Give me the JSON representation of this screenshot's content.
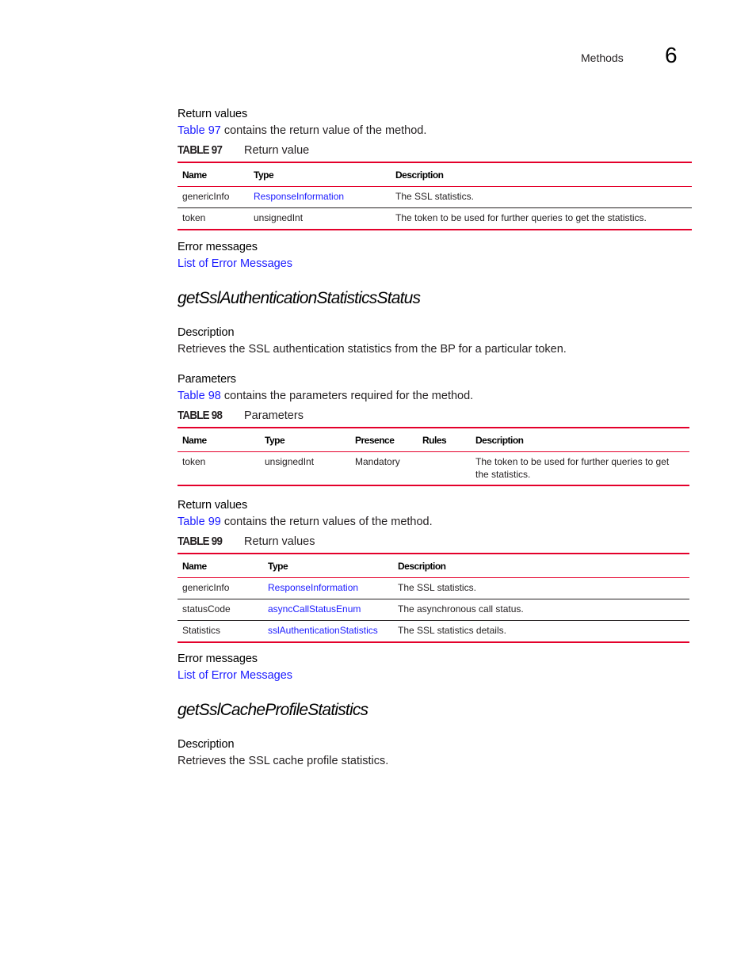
{
  "header": {
    "section": "Methods",
    "chapter": "6"
  },
  "block1": {
    "return_heading": "Return values",
    "intro_link": "Table 97",
    "intro_text": " contains the return value of the method.",
    "table": {
      "number": "TABLE 97",
      "caption": "Return value",
      "columns": [
        "Name",
        "Type",
        "Description"
      ],
      "rows": [
        {
          "name": "genericInfo",
          "type": "ResponseInformation",
          "type_is_link": true,
          "description": "The SSL statistics."
        },
        {
          "name": "token",
          "type": "unsignedInt",
          "type_is_link": false,
          "description": "The token to be used for further queries to get the statistics."
        }
      ]
    },
    "error_heading": "Error messages",
    "error_link": "List of Error Messages"
  },
  "method1": {
    "title": "getSslAuthenticationStatisticsStatus",
    "description_heading": "Description",
    "description": "Retrieves the SSL authentication statistics from the BP for a particular token.",
    "params_heading": "Parameters",
    "params_link": "Table 98",
    "params_text": " contains the parameters required for the method.",
    "params_table": {
      "number": "TABLE 98",
      "caption": "Parameters",
      "columns": [
        "Name",
        "Type",
        "Presence",
        "Rules",
        "Description"
      ],
      "rows": [
        {
          "name": "token",
          "type": "unsignedInt",
          "presence": "Mandatory",
          "rules": "",
          "description": "The token to be used for further queries to get the statistics."
        }
      ]
    },
    "return_heading": "Return values",
    "return_link": "Table 99",
    "return_text": " contains the return values of the method.",
    "return_table": {
      "number": "TABLE 99",
      "caption": "Return values",
      "columns": [
        "Name",
        "Type",
        "Description"
      ],
      "rows": [
        {
          "name": "genericInfo",
          "type": "ResponseInformation",
          "description": "The SSL statistics."
        },
        {
          "name": "statusCode",
          "type": "asyncCallStatusEnum",
          "description": "The asynchronous call status."
        },
        {
          "name": "Statistics",
          "type": "sslAuthenticationStatistics",
          "description": "The SSL statistics details."
        }
      ]
    },
    "error_heading": "Error messages",
    "error_link": "List of Error Messages"
  },
  "method2": {
    "title": "getSslCacheProfileStatistics",
    "description_heading": "Description",
    "description": "Retrieves the SSL cache profile statistics."
  },
  "colors": {
    "link": "#1a1aff",
    "table_rule": "#e4002b"
  }
}
